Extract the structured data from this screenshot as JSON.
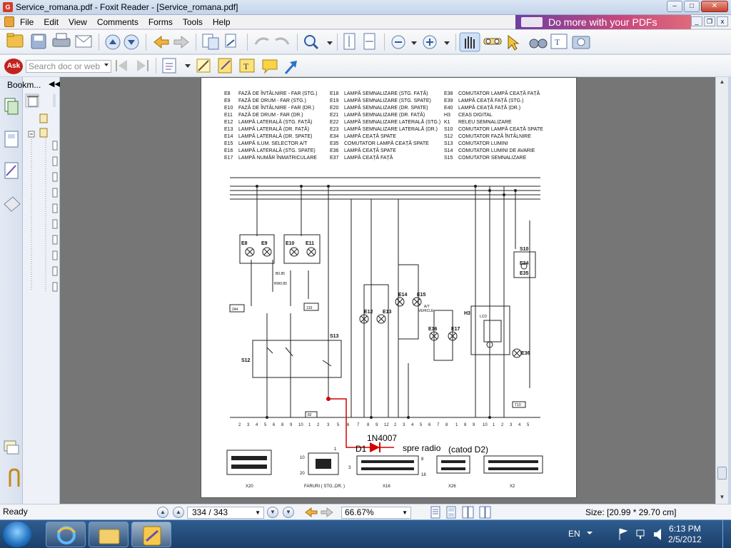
{
  "window": {
    "title": "Service_romana.pdf - Foxit Reader - [Service_romana.pdf]",
    "controls": {
      "minimize": "–",
      "maximize": "□",
      "close": "✕"
    },
    "doc_controls": {
      "minimize": "_",
      "restore": "❐",
      "close": "x"
    }
  },
  "menu": {
    "items": [
      "File",
      "Edit",
      "View",
      "Comments",
      "Forms",
      "Tools",
      "Help"
    ],
    "banner": "Do more with your PDFs"
  },
  "search": {
    "placeholder": "Search doc or web"
  },
  "sidebar": {
    "bookmarks_label": "Bookm..."
  },
  "document": {
    "legend": {
      "col1": [
        [
          "E8",
          "FAZĂ DE ÎNTÂLNIRE - FAR (STG.)"
        ],
        [
          "E9",
          "FAZĂ DE DRUM - FAR (STG.)"
        ],
        [
          "E10",
          "FAZĂ DE ÎNTÂLNIRE - FAR (DR.)"
        ],
        [
          "E11",
          "FAZĂ DE DRUM - FAR (DR.)"
        ],
        [
          "E12",
          "LAMPĂ LATERALĂ (STG. FAȚĂ)"
        ],
        [
          "E13",
          "LAMPĂ LATERALĂ (DR. FAȚĂ)"
        ],
        [
          "E14",
          "LAMPĂ LATERALĂ (DR. SPATE)"
        ],
        [
          "E15",
          "LAMPĂ ILUM. SELECTOR A/T"
        ],
        [
          "E16",
          "LAMPĂ LATERALĂ (STG. SPATE)"
        ],
        [
          "E17",
          "LAMPĂ NUMĂR ÎNMATRICULARE"
        ]
      ],
      "col2": [
        [
          "E18",
          "LAMPĂ SEMNALIZARE (STG. FAȚĂ)"
        ],
        [
          "E19",
          "LAMPĂ SEMNALIZARE (STG. SPATE)"
        ],
        [
          "E20",
          "LAMPĂ SEMNALIZARE (DR. SPATE)"
        ],
        [
          "E21",
          "LAMPĂ SEMNALIZARE (DR. FAȚĂ)"
        ],
        [
          "E22",
          "LAMPĂ SEMNALIZARE LATERALĂ (STG.)"
        ],
        [
          "E23",
          "LAMPĂ SEMNALIZARE LATERALĂ (DR.)"
        ],
        [
          "E34",
          "LAMPĂ CEAȚĂ SPATE"
        ],
        [
          "E35",
          "COMUTATOR LAMPĂ CEAȚĂ SPATE"
        ],
        [
          "E36",
          "LAMPĂ CEAȚĂ SPATE"
        ],
        [
          "E37",
          "LAMPĂ CEAȚĂ FAȚĂ"
        ]
      ],
      "col3": [
        [
          "E38",
          "COMUTATOR LAMPĂ CEAȚĂ FAȚĂ"
        ],
        [
          "E39",
          "LAMPĂ CEAȚĂ FAȚĂ (STG.)"
        ],
        [
          "E40",
          "LAMPĂ CEAȚĂ FAȚĂ (DR.)"
        ],
        [
          "H3",
          "CEAS DIGITAL"
        ],
        [
          "K1",
          "RELEU SEMNALIZARE"
        ],
        [
          "S10",
          "COMUTATOR LAMPĂ CEAȚĂ SPATE"
        ],
        [
          "S12",
          "COMUTATOR FAZĂ ÎNTÂLNIRE"
        ],
        [
          "S13",
          "COMUTATOR LUMINI"
        ],
        [
          "S14",
          "COMUTATOR LUMINI DE AVARIE"
        ],
        [
          "S15",
          "COMUTATOR SEMNALIZARE"
        ]
      ]
    },
    "labels": {
      "e8": "E8",
      "e9": "E9",
      "e10": "E10",
      "e11": "E11",
      "s12": "S12",
      "s13": "S13",
      "s10": "S10",
      "h3": "H3",
      "e12": "E12",
      "e13": "E13",
      "e14": "E14",
      "e15": "E15",
      "e16": "E16",
      "e17": "E17",
      "e34": "E34",
      "e35": "E35",
      "e36": "E36",
      "at": "A/T",
      "vehicle": "VEHICLE",
      "lcd": "LCD",
      "box_244": "244",
      "box_133": "133",
      "box_82": "82",
      "box_t10": "T10",
      "b085": "B0.85",
      "rw085": "RW0.85"
    },
    "connectors": [
      "X20",
      "FARURI  ( STG.,DR. )",
      "X16",
      "X26",
      "X2"
    ],
    "pin_numbers": [
      "10",
      "20",
      "1",
      "3",
      "8",
      "18"
    ],
    "annotations": {
      "diode_part": "1N4007",
      "diode_ref": "D1",
      "to_radio": "spre radio",
      "cathode": "(catod D2)"
    }
  },
  "status": {
    "ready": "Ready",
    "page": "334 / 343",
    "zoom": "66.67%",
    "size": "Size: [20.99 * 29.70 cm]"
  },
  "taskbar": {
    "lang": "EN",
    "time": "6:13 PM",
    "date": "2/5/2012"
  },
  "colors": {
    "annotation_red": "#d40000",
    "doc_bg": "#767676",
    "title_bg": "#c4d4ea"
  }
}
